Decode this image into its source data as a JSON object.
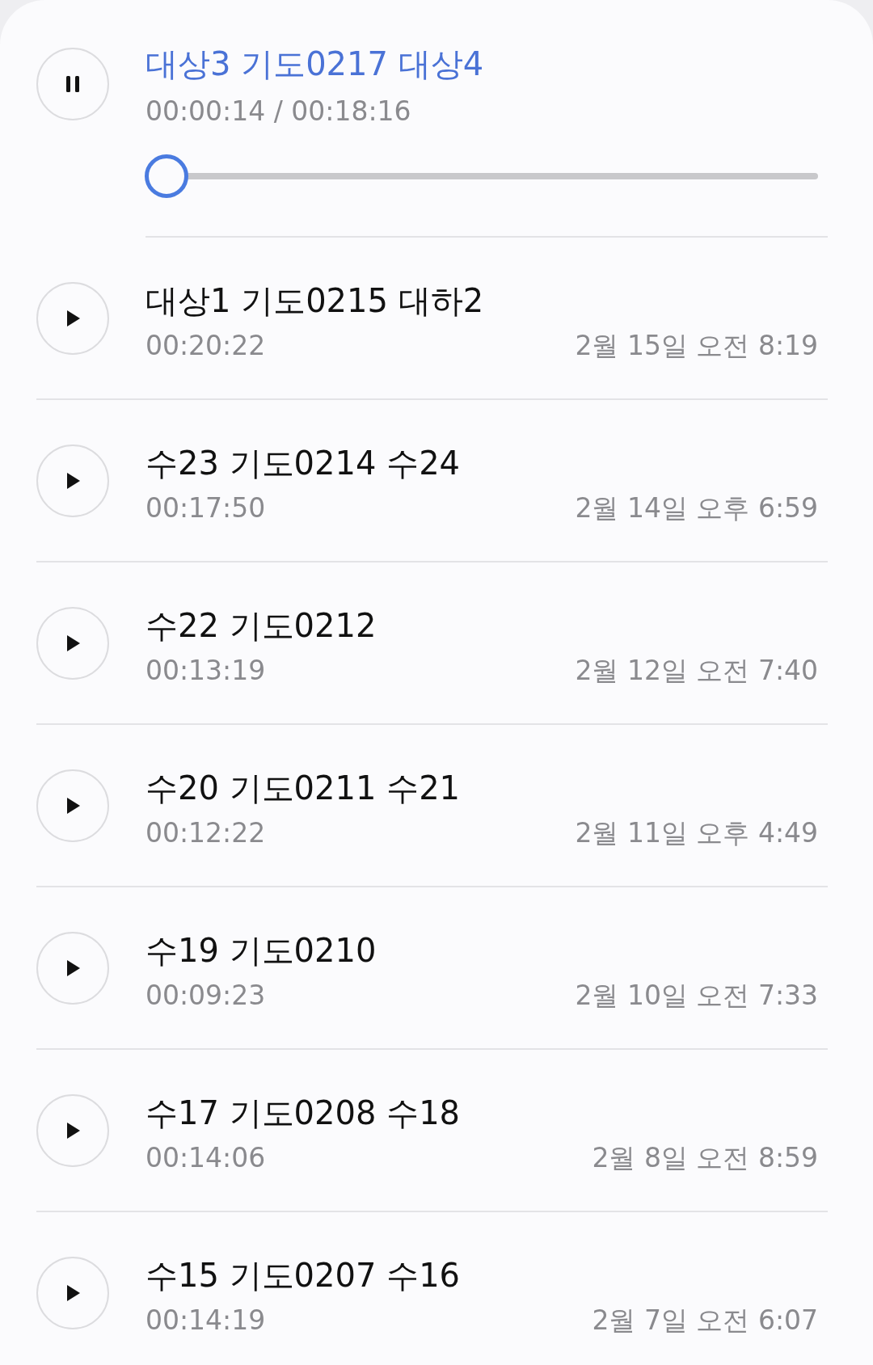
{
  "now_playing": {
    "title": "대상3 기도0217 대상4",
    "position": "00:00:14 / 00:18:16",
    "playing": true,
    "level": 0.013
  },
  "recordings": [
    {
      "title": "대상1 기도0215 대하2",
      "duration": "00:20:22",
      "date": "2월 15일 오전 8:19"
    },
    {
      "title": "수23 기도0214 수24",
      "duration": "00:17:50",
      "date": "2월 14일 오후 6:59"
    },
    {
      "title": "수22 기도0212",
      "duration": "00:13:19",
      "date": "2월 12일 오전 7:40"
    },
    {
      "title": "수20 기도0211 수21",
      "duration": "00:12:22",
      "date": "2월 11일 오후 4:49"
    },
    {
      "title": "수19 기도0210",
      "duration": "00:09:23",
      "date": "2월 10일 오전 7:33"
    },
    {
      "title": "수17 기도0208 수18",
      "duration": "00:14:06",
      "date": "2월 8일 오전 8:59"
    },
    {
      "title": "수15 기도0207 수16",
      "duration": "00:14:19",
      "date": "2월 7일 오전 6:07"
    }
  ]
}
